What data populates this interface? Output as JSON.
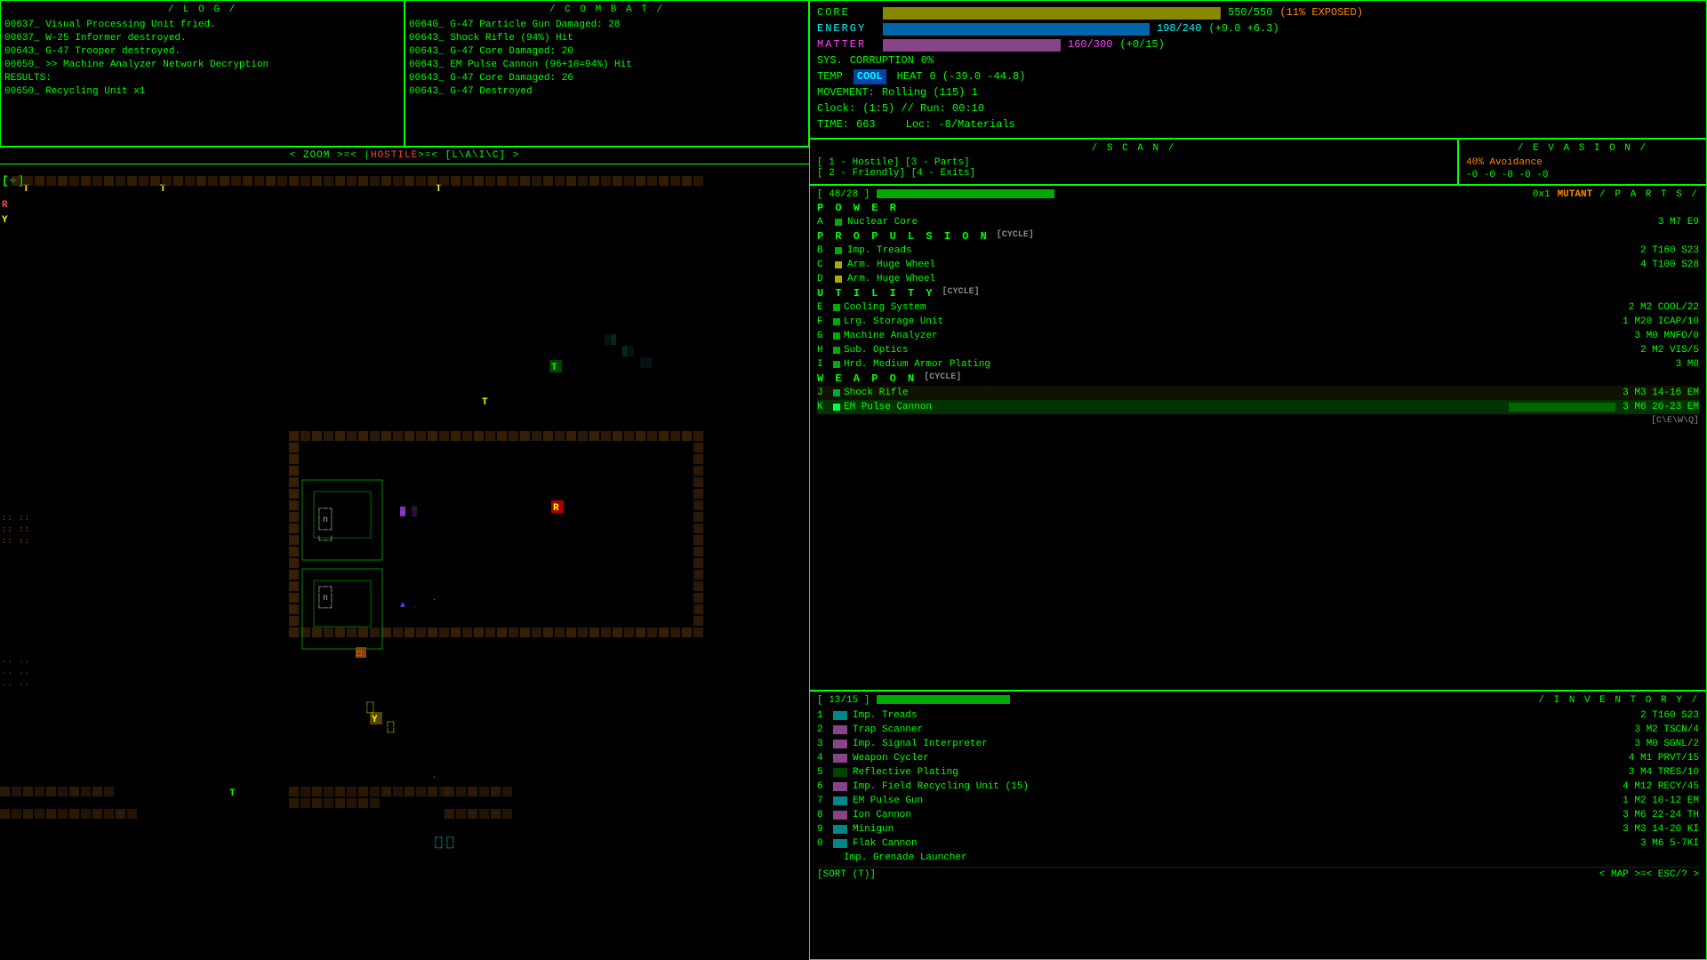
{
  "log": {
    "title": "/ L O G /",
    "entries": [
      "00637_  Visual Processing Unit fried.",
      "00637_  W-25 Informer destroyed.",
      "00643_  G-47 Trooper destroyed.",
      "00650_  >> Machine Analyzer Network Decryption",
      "          RESULTS:",
      "00650_     Recycling Unit x1"
    ]
  },
  "combat": {
    "title": "/ C O M B A T /",
    "entries": [
      "00640_    G-47 Particle Gun Damaged: 28",
      "00643_  Shock Rifle (94%) Hit",
      "00643_    G-47 Core Damaged: 20",
      "00643_  EM Pulse Cannon (96+10=94%) Hit",
      "00643_    G-47 Core Damaged: 26",
      "00643_    G-47 Destroyed"
    ]
  },
  "zoom_bar": "< ZOOM >=< | HOSTILE >=< [L\\A\\I\\C] >",
  "status": {
    "core_label": "CORE",
    "core_value": "550/550",
    "core_exposed": "(11% EXPOSED)",
    "energy_label": "ENERGY",
    "energy_value": "198/240",
    "energy_delta": "(+9.0 +6.3)",
    "matter_label": "MATTER",
    "matter_value": "160/300",
    "matter_delta": "(+0/15)",
    "sys_label": "SYS.",
    "corruption_label": "CORRUPTION",
    "corruption_value": "0%",
    "temp_label": "TEMP",
    "temp_badge": "COOL",
    "heat_label": "HEAT",
    "heat_value": "0 (-39.0 -44.8)",
    "movement_label": "MOVEMENT:",
    "movement_value": "Rolling (115) 1",
    "clock_label": "Clock:",
    "clock_value": "(1:5) // Run: 00:10",
    "time_label": "TIME:",
    "time_value": "663",
    "loc_label": "Loc:",
    "loc_value": "-8/Materials"
  },
  "scan": {
    "title": "/ S C A N /",
    "items": [
      "[ 1 - Hostile]  [3 - Parts]",
      "[ 2 - Friendly] [4 - Exits]"
    ]
  },
  "evasion": {
    "title": "/ E V A S I O N /",
    "avoidance": "40% Avoidance",
    "values": "-0  -0  -0  -0  -0"
  },
  "parts": {
    "title": "/ P A R T S /",
    "header_left": "[ 48/28 ]",
    "header_mid": "0x1",
    "header_badge": "MUTANT",
    "power_label": "P O W E R",
    "power_items": [
      {
        "key": "A",
        "dot": "green",
        "name": "Nuclear Core",
        "stats": "3 M7 E9"
      }
    ],
    "propulsion_label": "P R O P U L S I O N",
    "propulsion_cycle": "[CYCLE]",
    "propulsion_items": [
      {
        "key": "B",
        "dot": "green",
        "name": "Imp.  Treads",
        "stats": "2 T160 S23"
      },
      {
        "key": "C",
        "dot": "yellow",
        "name": "Arm.  Huge Wheel",
        "stats": "4 T100 S28"
      },
      {
        "key": "D",
        "dot": "yellow",
        "name": "Arm.  Huge Wheel",
        "stats": ""
      }
    ],
    "utility_label": "U T I L I T Y",
    "utility_cycle": "[CYCLE]",
    "utility_items": [
      {
        "key": "E",
        "dot": "green",
        "name": "Cooling System",
        "stats": "2 M2 COOL/22"
      },
      {
        "key": "F",
        "dot": "green",
        "name": "Lrg. Storage Unit",
        "stats": "1 M20 ICAP/10"
      },
      {
        "key": "G",
        "dot": "green",
        "name": "Machine Analyzer",
        "stats": "3 M0 MNFO/0"
      },
      {
        "key": "H",
        "dot": "green",
        "name": "Sub. Optics",
        "stats": "2 M2 VIS/5"
      },
      {
        "key": "I",
        "dot": "green",
        "name": "Hrd. Medium Armor Plating",
        "stats": "3 M8"
      }
    ],
    "weapon_label": "W E A P O N",
    "weapon_cycle": "[CYCLE]",
    "weapon_items": [
      {
        "key": "J",
        "dot": "weapon",
        "name": "Shock Rifle",
        "stats": "3 M3 14-16 EM",
        "selected": false
      },
      {
        "key": "K",
        "dot": "weapon",
        "name": "EM Pulse Cannon",
        "stats": "3 M6 20-23 EM",
        "selected": true
      }
    ],
    "footer": "[C\\E\\W\\Q]"
  },
  "inventory": {
    "title": "/ I N V E N T O R Y /",
    "header": "[ 13/15 ]",
    "footer_left": "[SORT (T)]",
    "footer_right": "< MAP >=< ESC/? >",
    "items": [
      {
        "key": "1",
        "icon": "teal",
        "name": "Imp.  Treads",
        "stats": "2 T160 S23"
      },
      {
        "key": "2",
        "icon": "magenta",
        "name": "Trap Scanner",
        "stats": "3 M2 TSCN/4"
      },
      {
        "key": "3",
        "icon": "magenta",
        "name": "Imp.  Signal Interpreter",
        "stats": "3 M0 SGNL/2"
      },
      {
        "key": "4",
        "icon": "magenta",
        "name": "Weapon Cycler",
        "stats": "4 M1 PRVT/15"
      },
      {
        "key": "5",
        "icon": "green",
        "name": "Reflective Plating",
        "stats": "3 M4 TRES/10"
      },
      {
        "key": "6",
        "icon": "magenta",
        "name": "Imp. Field Recycling Unit (15)",
        "stats": "4 M12 RECY/45"
      },
      {
        "key": "7",
        "icon": "teal",
        "name": "EM Pulse Gun",
        "stats": "1 M2 10-12 EM"
      },
      {
        "key": "8",
        "icon": "magenta",
        "name": "Ion Cannon",
        "stats": "3 M6 22-24 TH"
      },
      {
        "key": "9",
        "icon": "teal",
        "name": "Minigun",
        "stats": "3 M3 14-20 KI"
      },
      {
        "key": "0",
        "icon": "teal",
        "name": "Flak Cannon",
        "stats": "3 M6 5-7KI"
      },
      {
        "key": "",
        "icon": "none",
        "name": "Imp. Grenade Launcher",
        "stats": ""
      }
    ]
  }
}
